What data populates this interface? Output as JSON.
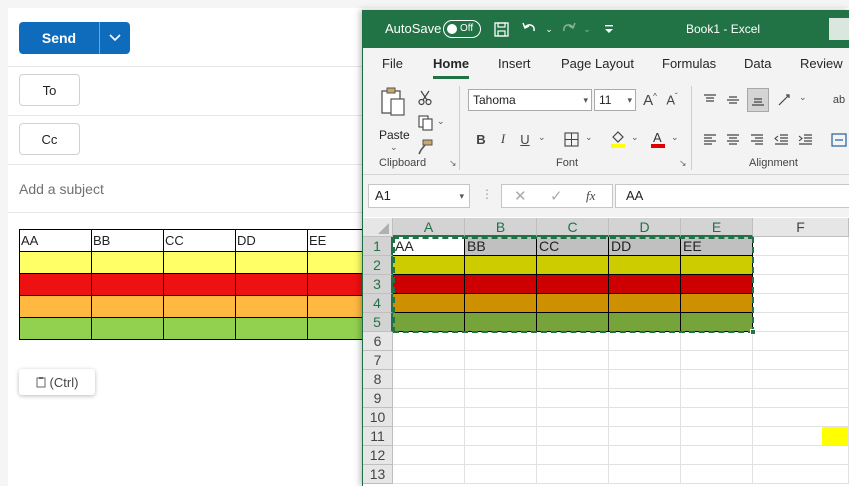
{
  "outlook": {
    "send_label": "Send",
    "to_label": "To",
    "cc_label": "Cc",
    "subject_placeholder": "Add a subject",
    "table_rows": [
      [
        "AA",
        "BB",
        "CC",
        "DD",
        "EE"
      ],
      [
        "",
        "",
        "",
        "",
        ""
      ],
      [
        "",
        "",
        "",
        "",
        ""
      ],
      [
        "",
        "",
        "",
        "",
        ""
      ],
      [
        "",
        "",
        "",
        "",
        ""
      ]
    ],
    "row_colors": [
      "#ffffff",
      "#ffff66",
      "#ee1111",
      "#ffb940",
      "#92d050"
    ],
    "paste_label": "(Ctrl)"
  },
  "excel": {
    "autosave_label": "AutoSave",
    "autosave_state": "Off",
    "title": "Book1  -  Excel",
    "menu": [
      "File",
      "Home",
      "Insert",
      "Page Layout",
      "Formulas",
      "Data",
      "Review"
    ],
    "active_menu": "Home",
    "ribbon": {
      "paste_label": "Paste",
      "clipboard_label": "Clipboard",
      "font_label": "Font",
      "alignment_label": "Alignment",
      "font_name": "Tahoma",
      "font_size": "11",
      "bold": "B",
      "italic": "I",
      "underline": "U"
    },
    "name_box": "A1",
    "formula_value": "AA",
    "columns": [
      "A",
      "B",
      "C",
      "D",
      "E",
      "F"
    ],
    "rows": [
      "1",
      "2",
      "3",
      "4",
      "5",
      "6",
      "7",
      "8",
      "9",
      "10",
      "11",
      "12",
      "13"
    ],
    "data_rows": [
      [
        "AA",
        "BB",
        "CC",
        "DD",
        "EE"
      ],
      [
        "",
        "",
        "",
        "",
        ""
      ],
      [
        "",
        "",
        "",
        "",
        ""
      ],
      [
        "",
        "",
        "",
        "",
        ""
      ],
      [
        "",
        "",
        "",
        "",
        ""
      ]
    ],
    "data_row_colors": [
      "#c0c0c0",
      "#cccc00",
      "#cc0000",
      "#cc9000",
      "#77a33b"
    ],
    "active_cell_color": "#ffffff",
    "highlight_color": "#ffff00"
  }
}
